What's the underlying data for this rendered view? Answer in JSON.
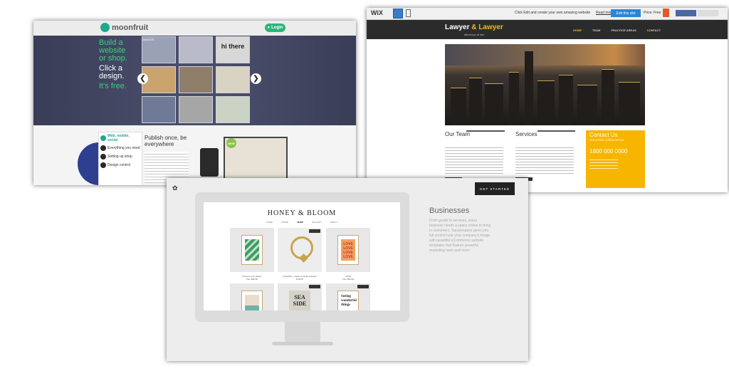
{
  "moonfruit": {
    "logo": "moonfruit",
    "login": "Login",
    "headline": [
      {
        "text": "Build a",
        "tone": "green"
      },
      {
        "text": "website",
        "tone": "green"
      },
      {
        "text": "or shop.",
        "tone": "green"
      },
      {
        "text": "Click a",
        "tone": "white"
      },
      {
        "text": "design.",
        "tone": "white"
      },
      {
        "text": "It's free.",
        "tone": "green"
      }
    ],
    "tile_label": "hi there",
    "tile_small_label": "IMAGES",
    "features": [
      "Web, mobile, social",
      "Everything you need",
      "Setting up shop",
      "Design control"
    ],
    "publish_title": "Publish once, be everywhere",
    "new_badge": "NEW",
    "colors": {
      "accent": "#39d17c",
      "hero": "#4a4e6a",
      "brand": "#1fa88d"
    }
  },
  "wix": {
    "logo": "WiX",
    "message": "Click Edit and create your own amazing website",
    "read_more": "Read more",
    "edit_button": "Edit this site",
    "price": "Price: Free",
    "brand_a": "Lawyer",
    "brand_amp": "&",
    "brand_b": "Lawyer",
    "tagline": "attorneys at law",
    "nav": [
      "HOME",
      "TEAM",
      "PRACTICE AREAS",
      "CONTACT"
    ],
    "col1_title": "Our Team",
    "col2_title": "Services",
    "contact_title": "Contact Us",
    "contact_sub": "FOR A FREE CONSULTATION",
    "contact_phone": "1800 000 0000",
    "colors": {
      "accent": "#f3b81d",
      "contact_bg": "#f7b500",
      "header": "#2b2b2b"
    }
  },
  "squarespace": {
    "cta": "GET STARTED",
    "store_name": "HONEY & BLOOM",
    "store_nav": [
      "HOME",
      "STORE",
      "SHOP",
      "GALLERY",
      "ABOUT"
    ],
    "products_row1": [
      {
        "caption": "Prints & Lyric Series",
        "price": "from $35.00",
        "art": "green",
        "badge": false
      },
      {
        "caption": "Gold Skin – Heart on Heart bracelet",
        "price": "$ 68.00",
        "art": "gold",
        "badge": true
      },
      {
        "caption": "LOVE",
        "price": "from $30.00",
        "art": "love",
        "badge": false
      }
    ],
    "products_row2": [
      {
        "art": "teal",
        "badge": false
      },
      {
        "art": "seaside",
        "badge": true
      },
      {
        "art": "seeing",
        "badge": true
      }
    ],
    "love_text": "LOVE",
    "seaside_text": "SEA SIDE",
    "seeing_text": "Seeing wonderful things",
    "title": "Businesses",
    "description": "From goods to services, every business needs a space online to bring in customers. Squarespace gives you full control over your company's image with beautiful eCommerce website templates that feature powerful marketing tools and more."
  }
}
